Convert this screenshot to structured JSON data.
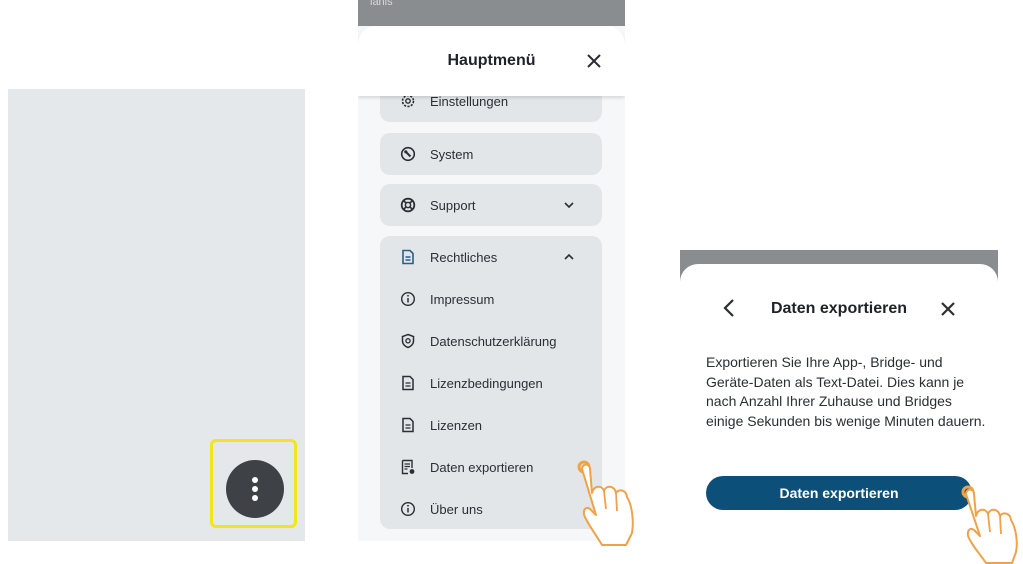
{
  "screen1": {
    "fab_icon": "more-vertical-icon"
  },
  "screen2": {
    "status_text": "lanis",
    "title": "Hauptmenü",
    "close_icon": "close-icon",
    "items": [
      {
        "label": "Einstellungen",
        "icon": "gear-icon"
      },
      {
        "label": "System",
        "icon": "wrench-icon"
      },
      {
        "label": "Support",
        "icon": "lifebuoy-icon",
        "expanded": false
      },
      {
        "label": "Rechtliches",
        "icon": "document-icon",
        "expanded": true
      }
    ],
    "legal_items": [
      {
        "label": "Impressum",
        "icon": "info-icon"
      },
      {
        "label": "Datenschutzerklärung",
        "icon": "shield-icon"
      },
      {
        "label": "Lizenzbedingungen",
        "icon": "document-icon"
      },
      {
        "label": "Lizenzen",
        "icon": "document-icon"
      },
      {
        "label": "Daten exportieren",
        "icon": "export-document-icon"
      },
      {
        "label": "Über uns",
        "icon": "info-icon"
      }
    ]
  },
  "screen3": {
    "title": "Daten exportieren",
    "body": "Exportieren Sie Ihre App-, Bridge- und Geräte-Daten als Text-Datei. Dies kann je nach Anzahl Ihrer Zuhause und Bridges einige Sekunden bis wenige Minuten dauern.",
    "button_label": "Daten exportieren"
  },
  "colors": {
    "panel_gray": "#e5e8eb",
    "highlight_yellow": "#f2e51e",
    "fab_dark": "#3e4247",
    "primary_button": "#0c4f78",
    "tap_hand_orange": "#f0a24a"
  }
}
